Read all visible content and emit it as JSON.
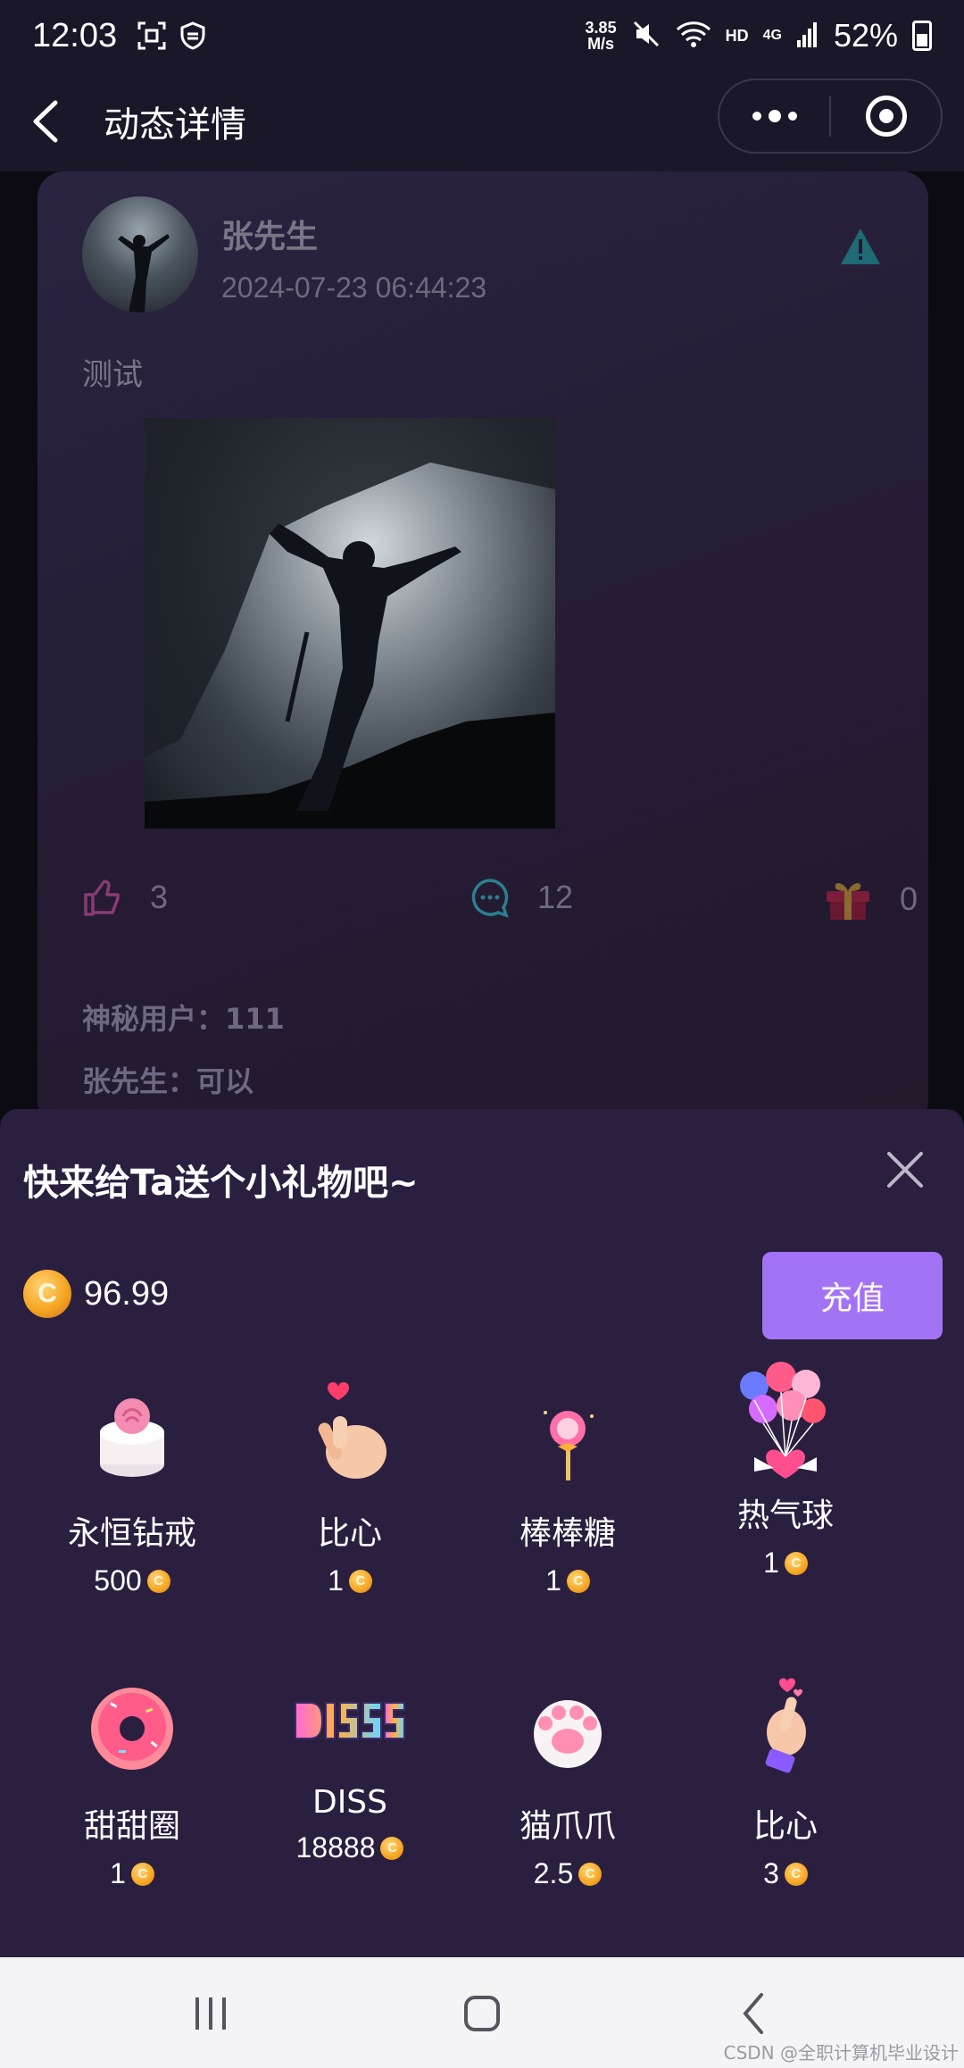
{
  "status_bar": {
    "time": "12:03",
    "net_speed_value": "3.85",
    "net_speed_unit": "M/s",
    "network": "HD",
    "signal": "4G",
    "battery": "52%"
  },
  "nav": {
    "title": "动态详情",
    "back_icon": "chevron-left-icon",
    "more_icon": "more-dots-icon",
    "close_icon": "target-icon"
  },
  "post": {
    "author": "张先生",
    "time": "2024-07-23 06:44:23",
    "text": "测试",
    "likes": "3",
    "comments": "12",
    "gifts": "0",
    "comment_list": [
      {
        "user": "神秘用户：",
        "text": "111"
      },
      {
        "user": "张先生：",
        "text": "可以"
      }
    ]
  },
  "gift_sheet": {
    "title": "快来给Ta送个小礼物吧~",
    "balance": "96.99",
    "recharge_label": "充值",
    "coin_glyph": "C",
    "gifts": [
      {
        "name": "永恒钻戒",
        "price": "500",
        "icon": "rose-cake-icon"
      },
      {
        "name": "比心",
        "price": "1",
        "icon": "finger-heart-icon"
      },
      {
        "name": "棒棒糖",
        "price": "1",
        "icon": "lollipop-icon"
      },
      {
        "name": "热气球",
        "price": "1",
        "icon": "balloons-icon"
      },
      {
        "name": "甜甜圈",
        "price": "1",
        "icon": "donut-icon"
      },
      {
        "name": "DISS",
        "price": "18888",
        "icon": "diss-icon"
      },
      {
        "name": "猫爪爪",
        "price": "2.5",
        "icon": "cat-paw-icon"
      },
      {
        "name": "比心",
        "price": "3",
        "icon": "hand-heart-icon"
      }
    ]
  },
  "watermark": "CSDN @全职计算机毕业设计",
  "colors": {
    "accent": "#a373f6",
    "sheet_bg": "#2a1f3f",
    "coin": "#f6a623"
  }
}
